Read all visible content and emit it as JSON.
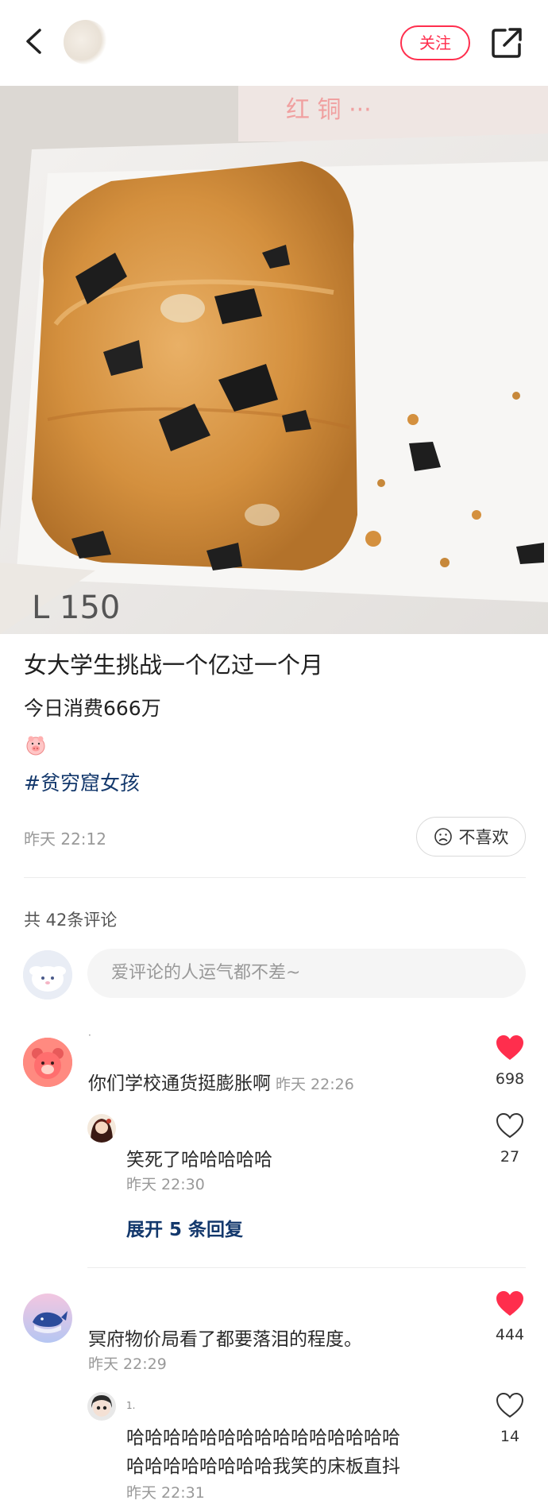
{
  "header": {
    "follow_label": "关注"
  },
  "post": {
    "title": "女大学生挑战一个亿过一个月",
    "body": "今日消费666万",
    "hashtag": "#贫穷窟女孩",
    "time": "昨天 22:12",
    "dislike_label": "不喜欢"
  },
  "comments_section": {
    "count_label": "共 42条评论",
    "input_placeholder": "爱评论的人运气都不差~"
  },
  "comments": [
    {
      "text": "你们学校通货挺膨胀啊",
      "time": "昨天 22:26",
      "likes": "698",
      "liked": true,
      "name": "·"
    },
    {
      "text": "笑死了哈哈哈哈哈",
      "time": "昨天 22:30",
      "likes": "27",
      "liked": false
    },
    {
      "text": "冥府物价局看了都要落泪的程度。",
      "time": "昨天 22:29",
      "likes": "444",
      "liked": true
    },
    {
      "name": "1.",
      "text_line1": "哈哈哈哈哈哈哈哈哈哈哈哈哈哈哈",
      "text_line2": "哈哈哈哈哈哈哈哈我笑的床板直抖",
      "time": "昨天 22:31",
      "likes": "14",
      "liked": false
    }
  ],
  "expand_replies_label": "展开 5 条回复",
  "colors": {
    "accent_red": "#ff2e4d",
    "link_blue": "#13386c",
    "muted": "#999999"
  }
}
